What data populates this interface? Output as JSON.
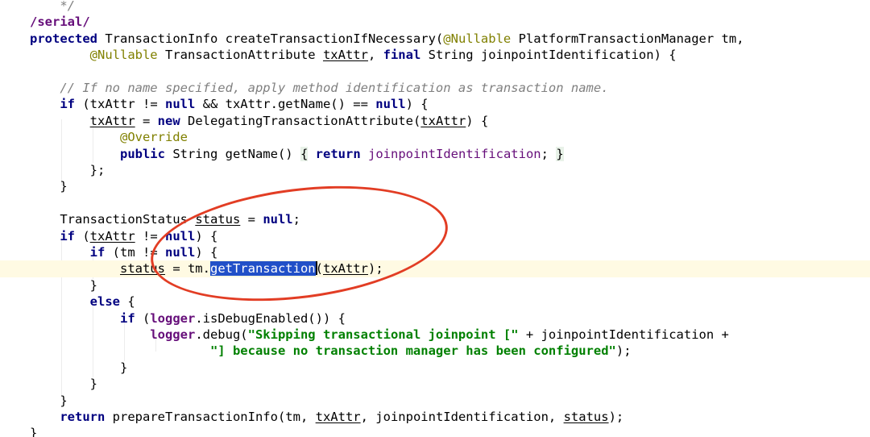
{
  "editor": {
    "lines": [
      {
        "segs": [
          {
            "t": "    */",
            "c": "cmt"
          }
        ]
      },
      {
        "segs": [
          {
            "t": "/serial/",
            "c": "fldb"
          }
        ]
      },
      {
        "segs": [
          {
            "t": "protected",
            "c": "kw"
          },
          {
            "t": " TransactionInfo createTransactionIfNecessary("
          },
          {
            "t": "@",
            "c": "ann"
          },
          {
            "t": "Nullable",
            "c": "ann"
          },
          {
            "t": " PlatformTransactionManager tm,"
          }
        ]
      },
      {
        "segs": [
          {
            "t": "        "
          },
          {
            "t": "@Nullable",
            "c": "ann"
          },
          {
            "t": " TransactionAttribute "
          },
          {
            "t": "txAttr",
            "c": "ul"
          },
          {
            "t": ", "
          },
          {
            "t": "final",
            "c": "kw"
          },
          {
            "t": " String joinpointIdentification) {"
          }
        ]
      },
      {
        "segs": [
          {
            "t": ""
          }
        ]
      },
      {
        "segs": [
          {
            "t": "    "
          },
          {
            "t": "// If no name specified, apply method identification as transaction name.",
            "c": "cmt"
          }
        ]
      },
      {
        "segs": [
          {
            "t": "    "
          },
          {
            "t": "if",
            "c": "kw"
          },
          {
            "t": " (txAttr != "
          },
          {
            "t": "null",
            "c": "kw"
          },
          {
            "t": " && txAttr.getName() == "
          },
          {
            "t": "null",
            "c": "kw"
          },
          {
            "t": ") {"
          }
        ]
      },
      {
        "segs": [
          {
            "t": "        "
          },
          {
            "t": "txAttr",
            "c": "ul"
          },
          {
            "t": " = "
          },
          {
            "t": "new",
            "c": "kw"
          },
          {
            "t": " DelegatingTransactionAttribute("
          },
          {
            "t": "txAttr",
            "c": "ul"
          },
          {
            "t": ") {"
          }
        ]
      },
      {
        "segs": [
          {
            "t": "            "
          },
          {
            "t": "@Override",
            "c": "ann"
          }
        ]
      },
      {
        "segs": [
          {
            "t": "            "
          },
          {
            "t": "public",
            "c": "kw"
          },
          {
            "t": " String getName() "
          },
          {
            "t": "{",
            "c": "brace-hl"
          },
          {
            "t": " "
          },
          {
            "t": "return",
            "c": "kw"
          },
          {
            "t": " "
          },
          {
            "t": "joinpointIdentification",
            "c": "fld"
          },
          {
            "t": "; "
          },
          {
            "t": "}",
            "c": "brace-hl"
          }
        ]
      },
      {
        "segs": [
          {
            "t": "        };"
          }
        ]
      },
      {
        "segs": [
          {
            "t": "    }"
          }
        ]
      },
      {
        "segs": [
          {
            "t": ""
          }
        ]
      },
      {
        "segs": [
          {
            "t": "    TransactionStatus "
          },
          {
            "t": "status",
            "c": "ul"
          },
          {
            "t": " = "
          },
          {
            "t": "null",
            "c": "kw"
          },
          {
            "t": ";"
          }
        ]
      },
      {
        "segs": [
          {
            "t": "    "
          },
          {
            "t": "if",
            "c": "kw"
          },
          {
            "t": " ("
          },
          {
            "t": "txAttr",
            "c": "ul"
          },
          {
            "t": " != "
          },
          {
            "t": "null",
            "c": "kw"
          },
          {
            "t": ") {"
          }
        ]
      },
      {
        "segs": [
          {
            "t": "        "
          },
          {
            "t": "if",
            "c": "kw"
          },
          {
            "t": " (tm != "
          },
          {
            "t": "null",
            "c": "kw"
          },
          {
            "t": ") {"
          }
        ]
      },
      {
        "segs": [
          {
            "t": "            "
          },
          {
            "t": "status",
            "c": "ul"
          },
          {
            "t": " = tm."
          },
          {
            "t": "getTransaction",
            "c": "sel"
          },
          {
            "t": "",
            "c": "caret"
          },
          {
            "t": "("
          },
          {
            "t": "txAttr",
            "c": "ul"
          },
          {
            "t": ");"
          }
        ],
        "current": true
      },
      {
        "segs": [
          {
            "t": "        }"
          }
        ]
      },
      {
        "segs": [
          {
            "t": "        "
          },
          {
            "t": "else",
            "c": "kw"
          },
          {
            "t": " {"
          }
        ]
      },
      {
        "segs": [
          {
            "t": "            "
          },
          {
            "t": "if",
            "c": "kw"
          },
          {
            "t": " ("
          },
          {
            "t": "logger",
            "c": "fldb"
          },
          {
            "t": ".isDebugEnabled()) {"
          }
        ]
      },
      {
        "segs": [
          {
            "t": "                "
          },
          {
            "t": "logger",
            "c": "fldb"
          },
          {
            "t": ".debug("
          },
          {
            "t": "\"Skipping transactional joinpoint [\"",
            "c": "str"
          },
          {
            "t": " + joinpointIdentification +"
          }
        ]
      },
      {
        "segs": [
          {
            "t": "                        "
          },
          {
            "t": "\"] because no transaction manager has been configured\"",
            "c": "str"
          },
          {
            "t": ");"
          }
        ]
      },
      {
        "segs": [
          {
            "t": "            }"
          }
        ]
      },
      {
        "segs": [
          {
            "t": "        }"
          }
        ]
      },
      {
        "segs": [
          {
            "t": "    }"
          }
        ]
      },
      {
        "segs": [
          {
            "t": "    "
          },
          {
            "t": "return",
            "c": "kw"
          },
          {
            "t": " prepareTransactionInfo(tm, "
          },
          {
            "t": "txAttr",
            "c": "ul"
          },
          {
            "t": ", joinpointIdentification, "
          },
          {
            "t": "status",
            "c": "ul"
          },
          {
            "t": ");"
          }
        ]
      },
      {
        "segs": [
          {
            "t": "}"
          }
        ]
      }
    ]
  },
  "colors": {
    "keyword": "#000080",
    "annotation": "#808000",
    "comment": "#808080",
    "string": "#008000",
    "field": "#660e7a",
    "selection": "#2150c8",
    "current_line": "#fffae3",
    "annotation_circle": "#e23d24"
  }
}
